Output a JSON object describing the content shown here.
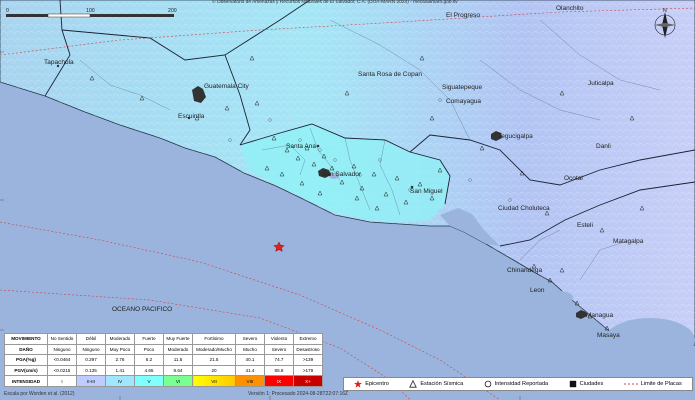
{
  "map": {
    "copyright": "© Observatorio de Amenazas y Recursos Naturales de El Salvador, C.A. (DOA-MARN 2024) - mecaoiamarn.gob.sv",
    "scale_labels": [
      "0",
      "100",
      "200"
    ],
    "ocean_label": "OCEANO PACIFICO",
    "north_label": "N",
    "places": [
      "Tapachula",
      "Guatemala City",
      "Escuintla",
      "Santa Ana",
      "San Salvador",
      "San Miguel",
      "Santa Rosa de Copan",
      "Siguatepeque",
      "Comayagua",
      "Tegucigalpa",
      "El Progreso",
      "Olanchito",
      "Juticalpa",
      "Danli",
      "Ocotal",
      "Ciudad Choluteca",
      "Esteli",
      "Matagalpa",
      "Chinandega",
      "Leon",
      "Managua",
      "Masaya"
    ],
    "version": "Versión 1: Procesado 2024-08-28T22:07:16Z",
    "credit": "Escala por Worden et al. (2012)"
  },
  "intensity_table": {
    "headers": [
      "MOVIMIENTO",
      "DAÑO",
      "PGA(%g)",
      "PGV(cm/s)",
      "INTENSIDAD"
    ],
    "movimiento": [
      "No Sentido",
      "Débil",
      "Moderado",
      "Fuerte",
      "Muy Fuerte",
      "Fortísimo",
      "Severo",
      "Violento",
      "Extremo"
    ],
    "dano": [
      "Ninguno",
      "Ninguno",
      "Muy Poco",
      "Poco",
      "Moderado",
      "Moderado/Mucho",
      "Mucho",
      "Severo",
      "Desastroso"
    ],
    "pga": [
      "<0.0464",
      "0.297",
      "2.76",
      "6.2",
      "11.5",
      "21.5",
      "40.1",
      "74.7",
      ">139"
    ],
    "pgv": [
      "<0.0215",
      "0.135",
      "1.41",
      "4.65",
      "9.64",
      "20",
      "41.4",
      "85.8",
      ">178"
    ],
    "intensidad": [
      "I",
      "II-III",
      "IV",
      "V",
      "VI",
      "VII",
      "VIII",
      "IX",
      "X+"
    ],
    "colors": [
      "#ffffff",
      "#bfccff",
      "#a0e6ff",
      "#80ffff",
      "#7aff93",
      "#ffff00",
      "#ffc800",
      "#ff9100",
      "#ff0000",
      "#c80000"
    ]
  },
  "legend": {
    "epicenter": "Epicentro",
    "station": "Estación Sísmica",
    "reported": "Intensidad Reportada",
    "cities": "Ciudades",
    "plates": "Limite de Placas"
  }
}
